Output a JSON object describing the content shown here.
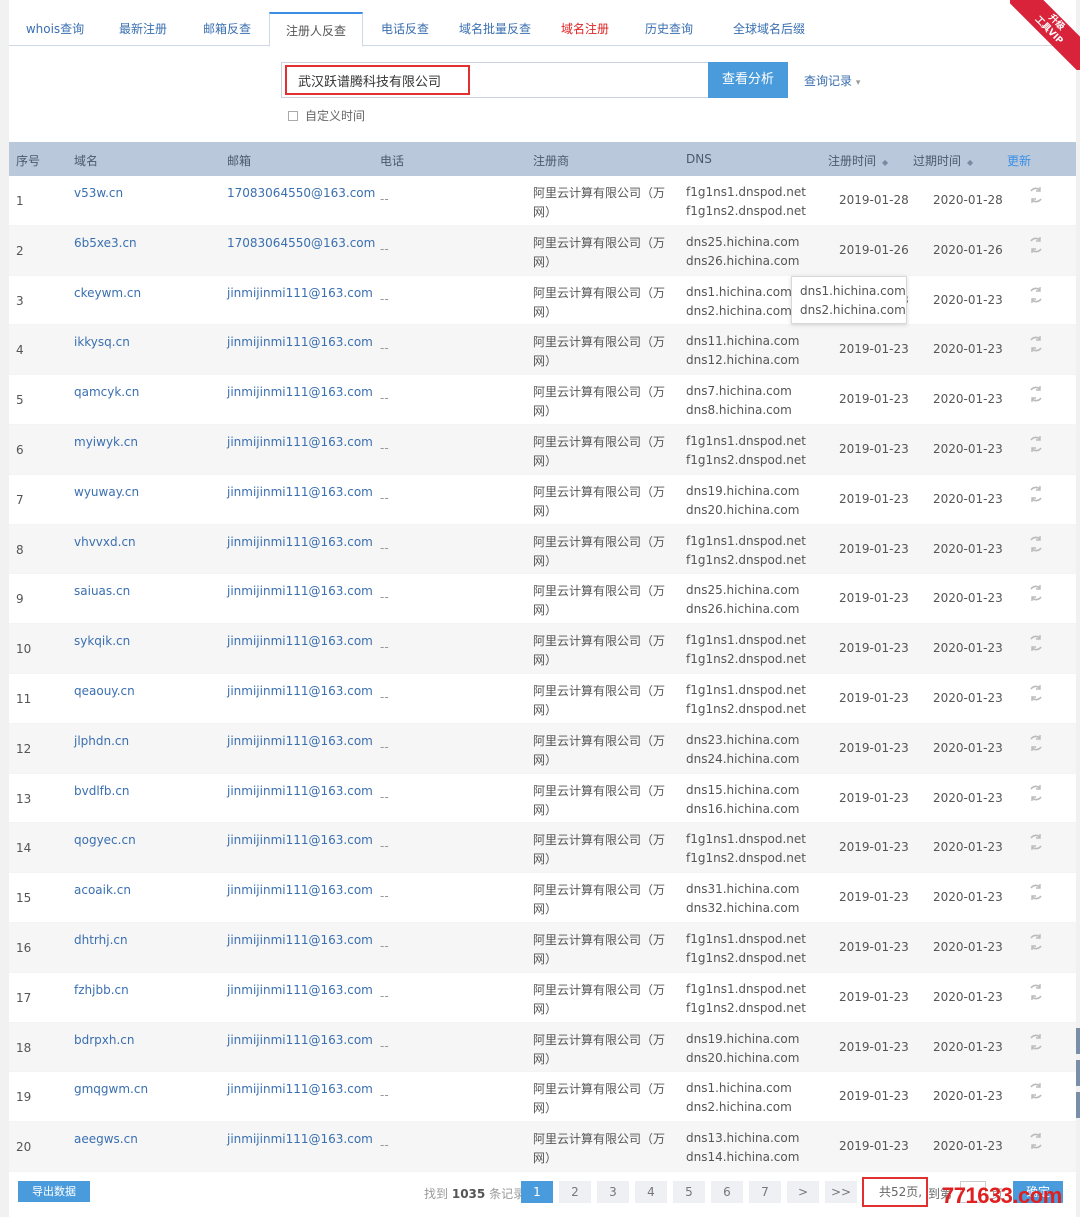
{
  "tabs": [
    {
      "label": "whois查询",
      "color": "blue"
    },
    {
      "label": "最新注册",
      "color": "blue"
    },
    {
      "label": "邮箱反查",
      "color": "blue"
    },
    {
      "label": "注册人反查",
      "color": "active"
    },
    {
      "label": "电话反查",
      "color": "blue"
    },
    {
      "label": "域名批量反查",
      "color": "blue"
    },
    {
      "label": "域名注册",
      "color": "red"
    },
    {
      "label": "历史查询",
      "color": "blue"
    },
    {
      "label": "全球域名后缀",
      "color": "blue"
    }
  ],
  "vip": {
    "line1": "升级",
    "line2": "工具VIP"
  },
  "search": {
    "value": "武汉跃谱腾科技有限公司",
    "button": "查看分析",
    "history": "查询记录",
    "custom_time": "自定义时间"
  },
  "table": {
    "headers": {
      "idx": "序号",
      "domain": "域名",
      "email": "邮箱",
      "phone": "电话",
      "registrar": "注册商",
      "dns": "DNS",
      "reg_date": "注册时间",
      "exp_date": "过期时间",
      "update": "更新"
    },
    "rows": [
      {
        "idx": "1",
        "domain": "v53w.cn",
        "email": "17083064550@163.com",
        "phone": "--",
        "registrar": "阿里云计算有限公司（万网）",
        "dns1": "f1g1ns1.dnspod.net",
        "dns2": "f1g1ns2.dnspod.net",
        "reg": "2019-01-28",
        "exp": "2020-01-28"
      },
      {
        "idx": "2",
        "domain": "6b5xe3.cn",
        "email": "17083064550@163.com",
        "phone": "--",
        "registrar": "阿里云计算有限公司（万网）",
        "dns1": "dns25.hichina.com",
        "dns2": "dns26.hichina.com",
        "reg": "2019-01-26",
        "exp": "2020-01-26"
      },
      {
        "idx": "3",
        "domain": "ckeywm.cn",
        "email": "jinmijinmi111@163.com",
        "phone": "--",
        "registrar": "阿里云计算有限公司（万网）",
        "dns1": "dns1.hichina.com",
        "dns2": "dns2.hichina.com",
        "reg": "2019-01-23",
        "exp": "2020-01-23"
      },
      {
        "idx": "4",
        "domain": "ikkysq.cn",
        "email": "jinmijinmi111@163.com",
        "phone": "--",
        "registrar": "阿里云计算有限公司（万网）",
        "dns1": "dns11.hichina.com",
        "dns2": "dns12.hichina.com",
        "reg": "2019-01-23",
        "exp": "2020-01-23"
      },
      {
        "idx": "5",
        "domain": "qamcyk.cn",
        "email": "jinmijinmi111@163.com",
        "phone": "--",
        "registrar": "阿里云计算有限公司（万网）",
        "dns1": "dns7.hichina.com",
        "dns2": "dns8.hichina.com",
        "reg": "2019-01-23",
        "exp": "2020-01-23"
      },
      {
        "idx": "6",
        "domain": "myiwyk.cn",
        "email": "jinmijinmi111@163.com",
        "phone": "--",
        "registrar": "阿里云计算有限公司（万网）",
        "dns1": "f1g1ns1.dnspod.net",
        "dns2": "f1g1ns2.dnspod.net",
        "reg": "2019-01-23",
        "exp": "2020-01-23"
      },
      {
        "idx": "7",
        "domain": "wyuway.cn",
        "email": "jinmijinmi111@163.com",
        "phone": "--",
        "registrar": "阿里云计算有限公司（万网）",
        "dns1": "dns19.hichina.com",
        "dns2": "dns20.hichina.com",
        "reg": "2019-01-23",
        "exp": "2020-01-23"
      },
      {
        "idx": "8",
        "domain": "vhvvxd.cn",
        "email": "jinmijinmi111@163.com",
        "phone": "--",
        "registrar": "阿里云计算有限公司（万网）",
        "dns1": "f1g1ns1.dnspod.net",
        "dns2": "f1g1ns2.dnspod.net",
        "reg": "2019-01-23",
        "exp": "2020-01-23"
      },
      {
        "idx": "9",
        "domain": "saiuas.cn",
        "email": "jinmijinmi111@163.com",
        "phone": "--",
        "registrar": "阿里云计算有限公司（万网）",
        "dns1": "dns25.hichina.com",
        "dns2": "dns26.hichina.com",
        "reg": "2019-01-23",
        "exp": "2020-01-23"
      },
      {
        "idx": "10",
        "domain": "sykqik.cn",
        "email": "jinmijinmi111@163.com",
        "phone": "--",
        "registrar": "阿里云计算有限公司（万网）",
        "dns1": "f1g1ns1.dnspod.net",
        "dns2": "f1g1ns2.dnspod.net",
        "reg": "2019-01-23",
        "exp": "2020-01-23"
      },
      {
        "idx": "11",
        "domain": "qeaouy.cn",
        "email": "jinmijinmi111@163.com",
        "phone": "--",
        "registrar": "阿里云计算有限公司（万网）",
        "dns1": "f1g1ns1.dnspod.net",
        "dns2": "f1g1ns2.dnspod.net",
        "reg": "2019-01-23",
        "exp": "2020-01-23"
      },
      {
        "idx": "12",
        "domain": "jlphdn.cn",
        "email": "jinmijinmi111@163.com",
        "phone": "--",
        "registrar": "阿里云计算有限公司（万网）",
        "dns1": "dns23.hichina.com",
        "dns2": "dns24.hichina.com",
        "reg": "2019-01-23",
        "exp": "2020-01-23"
      },
      {
        "idx": "13",
        "domain": "bvdlfb.cn",
        "email": "jinmijinmi111@163.com",
        "phone": "--",
        "registrar": "阿里云计算有限公司（万网）",
        "dns1": "dns15.hichina.com",
        "dns2": "dns16.hichina.com",
        "reg": "2019-01-23",
        "exp": "2020-01-23"
      },
      {
        "idx": "14",
        "domain": "qogyec.cn",
        "email": "jinmijinmi111@163.com",
        "phone": "--",
        "registrar": "阿里云计算有限公司（万网）",
        "dns1": "f1g1ns1.dnspod.net",
        "dns2": "f1g1ns2.dnspod.net",
        "reg": "2019-01-23",
        "exp": "2020-01-23"
      },
      {
        "idx": "15",
        "domain": "acoaik.cn",
        "email": "jinmijinmi111@163.com",
        "phone": "--",
        "registrar": "阿里云计算有限公司（万网）",
        "dns1": "dns31.hichina.com",
        "dns2": "dns32.hichina.com",
        "reg": "2019-01-23",
        "exp": "2020-01-23"
      },
      {
        "idx": "16",
        "domain": "dhtrhj.cn",
        "email": "jinmijinmi111@163.com",
        "phone": "--",
        "registrar": "阿里云计算有限公司（万网）",
        "dns1": "f1g1ns1.dnspod.net",
        "dns2": "f1g1ns2.dnspod.net",
        "reg": "2019-01-23",
        "exp": "2020-01-23"
      },
      {
        "idx": "17",
        "domain": "fzhjbb.cn",
        "email": "jinmijinmi111@163.com",
        "phone": "--",
        "registrar": "阿里云计算有限公司（万网）",
        "dns1": "f1g1ns1.dnspod.net",
        "dns2": "f1g1ns2.dnspod.net",
        "reg": "2019-01-23",
        "exp": "2020-01-23"
      },
      {
        "idx": "18",
        "domain": "bdrpxh.cn",
        "email": "jinmijinmi111@163.com",
        "phone": "--",
        "registrar": "阿里云计算有限公司（万网）",
        "dns1": "dns19.hichina.com",
        "dns2": "dns20.hichina.com",
        "reg": "2019-01-23",
        "exp": "2020-01-23"
      },
      {
        "idx": "19",
        "domain": "gmqgwm.cn",
        "email": "jinmijinmi111@163.com",
        "phone": "--",
        "registrar": "阿里云计算有限公司（万网）",
        "dns1": "dns1.hichina.com",
        "dns2": "dns2.hichina.com",
        "reg": "2019-01-23",
        "exp": "2020-01-23"
      },
      {
        "idx": "20",
        "domain": "aeegws.cn",
        "email": "jinmijinmi111@163.com",
        "phone": "--",
        "registrar": "阿里云计算有限公司（万网）",
        "dns1": "dns13.hichina.com",
        "dns2": "dns14.hichina.com",
        "reg": "2019-01-23",
        "exp": "2020-01-23"
      }
    ]
  },
  "tooltip": {
    "line1": "dns1.hichina.com",
    "line2": "dns2.hichina.com"
  },
  "footer": {
    "export": "导出数据",
    "found_prefix": "找到",
    "found_count": "1035",
    "found_suffix": "条记录",
    "pages": [
      "1",
      "2",
      "3",
      "4",
      "5",
      "6",
      "7",
      ">",
      ">>"
    ],
    "total_pages": "共52页,",
    "goto": "到第",
    "page_unit": "页",
    "confirm": "确定"
  },
  "watermark": "771633.com",
  "colors": {
    "accent": "#4a9bdc",
    "link": "#3a6fb0",
    "header_bg": "#b9c9db",
    "highlight": "#e03030"
  }
}
